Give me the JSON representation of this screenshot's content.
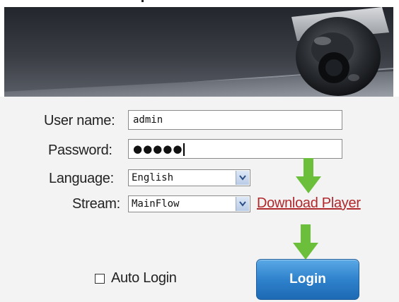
{
  "form": {
    "username_label": "User name:",
    "username_value": "admin",
    "password_label": "Password:",
    "password_display": "●●●●●",
    "language_label": "Language:",
    "language_value": "English",
    "stream_label": "Stream:",
    "stream_value": "MainFlow"
  },
  "links": {
    "download_player": "Download Player"
  },
  "auto_login_label": "Auto Login",
  "login_button": "Login",
  "icons": {
    "dropdown": "chevron-down-icon",
    "arrow": "arrow-down-icon",
    "camera": "dome-camera-icon"
  },
  "colors": {
    "link": "#b0282c",
    "arrow": "#6cbf3a",
    "button": "#2f82cc"
  }
}
